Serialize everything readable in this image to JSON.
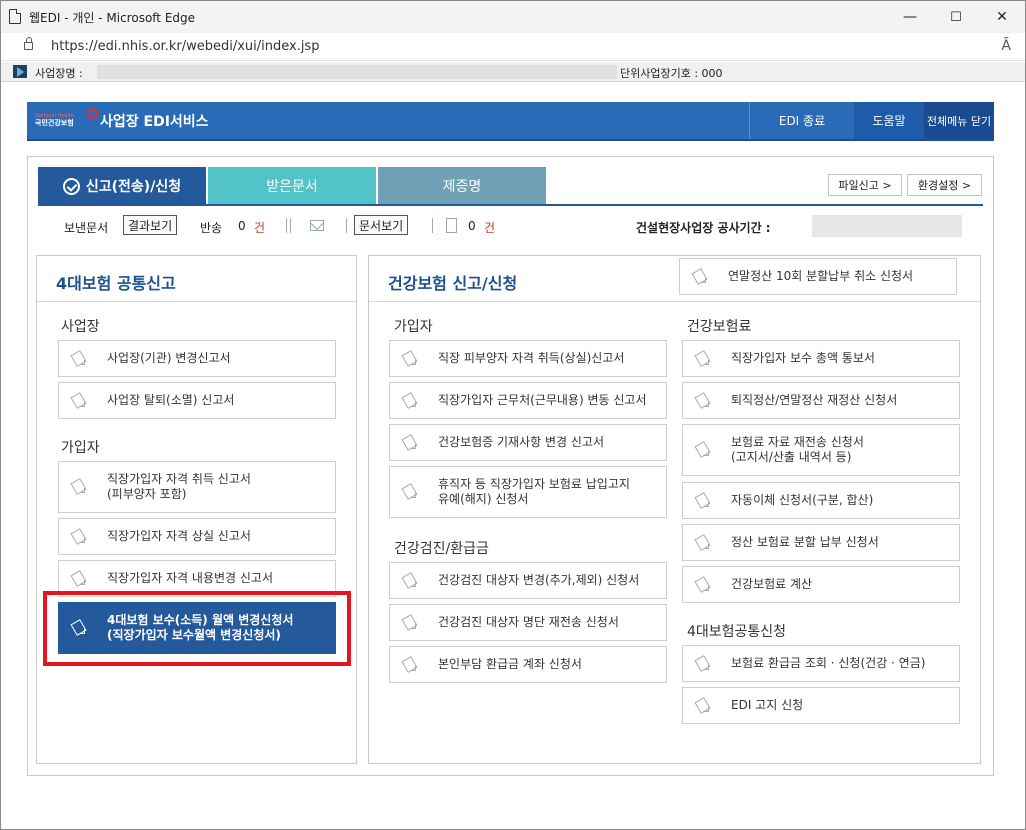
{
  "window": {
    "title": "웹EDI - 개인 - Microsoft Edge",
    "url": "https://edi.nhis.or.kr/webedi/xui/index.jsp",
    "minimize": "—",
    "maximize": "☐",
    "close": "✕",
    "read_aloud": "Ã"
  },
  "infobar": {
    "workplace_label": "사업장명 :",
    "unit_no": "단위사업장기호 : 000"
  },
  "header": {
    "logo_small": "국민건강보험",
    "logo_sub": "National Health",
    "service": "사업장 EDI서비스",
    "edi_exit": "EDI 종료",
    "help": "도움말",
    "close_all": "전체메뉴 닫기"
  },
  "tabs": {
    "report": "신고(전송)/신청",
    "received": "받은문서",
    "certificate": "제증명"
  },
  "top_buttons": {
    "file_report": "파일신고 >",
    "settings": "환경설정 >"
  },
  "subbar": {
    "sent": "보낸문서",
    "result_view": "결과보기",
    "returned": "반송",
    "returned_count": "0",
    "unit": "건",
    "doc_view": "문서보기",
    "doc_count": "0",
    "construction": "건설현장사업장 공사기간 :"
  },
  "left": {
    "title": "4대보험 공통신고",
    "sec1": "사업장",
    "sec1_items": [
      "사업장(기관) 변경신고서",
      "사업장 탈퇴(소멸) 신고서"
    ],
    "sec2": "가입자",
    "sec2_item1_l1": "직장가입자 자격 취득 신고서",
    "sec2_item1_l2": "(피부양자 포함)",
    "sec2_items": [
      "직장가입자 자격 상실 신고서",
      "직장가입자 자격 내용변경 신고서"
    ],
    "selected_l1": "4대보험 보수(소득) 월액 변경신청서",
    "selected_l2": "(직장가입자 보수월액 변경신청서)"
  },
  "right": {
    "title": "건강보험 신고/신청",
    "top_item": "연말정산 10회 분할납부 취소 신청서",
    "colA_sec1": "가입자",
    "colA_sec1_items": [
      "직장 피부양자 자격 취득(상실)신고서",
      "직장가입자 근무처(근무내용) 변동 신고서",
      "건강보험증 기재사항 변경 신고서"
    ],
    "colA_tall_l1": "휴직자 등 직장가입자 보험료 납입고지",
    "colA_tall_l2": "유예(해지) 신청서",
    "colA_sec2": "건강검진/환급금",
    "colA_sec2_items": [
      "건강검진 대상자 변경(추가,제외) 신청서",
      "건강검진 대상자 명단 재전송 신청서",
      "본인부담 환급금 계좌 신청서"
    ],
    "colB_sec1": "건강보험료",
    "colB_sec1_items": [
      "직장가입자 보수 총액 통보서",
      "퇴직정산/연말정산 재정산 신청서"
    ],
    "colB_tall_l1": "보험료 자료 재전송 신청서",
    "colB_tall_l2": "(고지서/산출 내역서 등)",
    "colB_sec1_items2": [
      "자동이체 신청서(구분, 합산)",
      "정산 보험료 분할 납부 신청서",
      "건강보험료 계산"
    ],
    "colB_sec2": "4대보험공통신청",
    "colB_sec2_items": [
      "보험료 환급금 조회 · 신청(건강 · 연금)",
      "EDI 고지 신청"
    ]
  }
}
